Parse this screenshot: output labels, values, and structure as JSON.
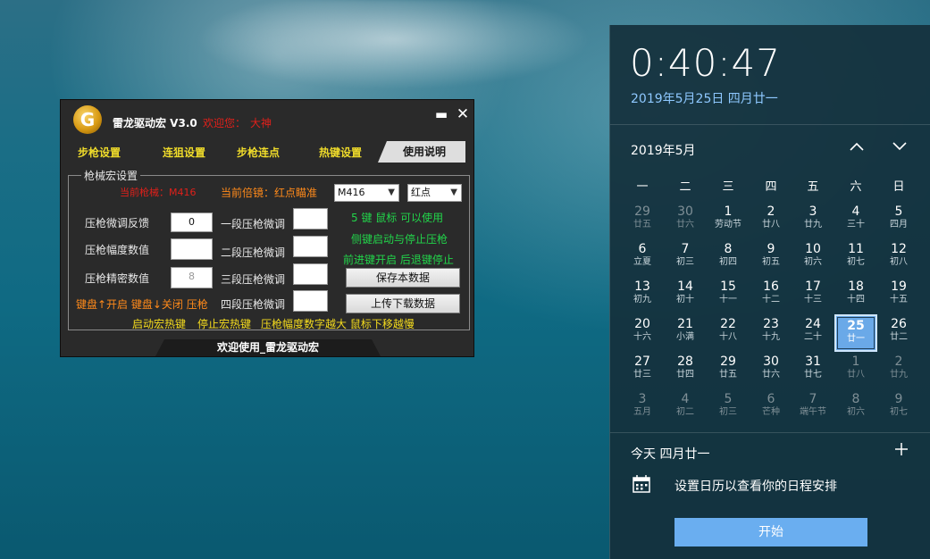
{
  "app": {
    "title": "雷龙驱动宏 V3.0",
    "welcome": "欢迎您：",
    "user": "大神",
    "logo_letter": "G",
    "min_icon": "▬",
    "close_icon": "✕",
    "tabs": [
      "步枪设置",
      "连狙设置",
      "步枪连点",
      "热键设置",
      "使用说明"
    ],
    "group_title": "枪械宏设置",
    "current_gun": "当前枪械：M416",
    "current_scope": "当前倍镜：红点瞄准",
    "gun_select": "M416",
    "scope_select": "红点",
    "fields": {
      "fine_tune_label": "压枪微调反馈",
      "fine_tune_value": "0",
      "amplitude_label": "压枪幅度数值",
      "amplitude_value": "",
      "precision_label": "压枪精密数值",
      "precision_value": "8",
      "stage1_label": "一段压枪微调",
      "stage2_label": "二段压枪微调",
      "stage3_label": "三段压枪微调",
      "stage4_label": "四段压枪微调"
    },
    "hint_mouse5": "5 键 鼠标 可以使用",
    "hint_side": "侧键启动与停止压枪",
    "hint_forward": "前进键开启 后退键停止",
    "save_button": "保存本数据",
    "upload_button": "上传下载数据",
    "keyboard_hint": "键盘↑开启 键盘↓关闭 压枪",
    "bottom_hint1": "启动宏热键",
    "bottom_hint2": "停止宏热键",
    "bottom_hint3": "压枪幅度数字越大 鼠标下移越慢",
    "footer": "欢迎使用_雷龙驱动宏"
  },
  "calendar": {
    "time": "0:40:47",
    "full_date": "2019年5月25日 四月廿一",
    "month": "2019年5月",
    "up_icon": "chevron-up-icon",
    "down_icon": "chevron-down-icon",
    "weekdays": [
      "一",
      "二",
      "三",
      "四",
      "五",
      "六",
      "日"
    ],
    "days": [
      {
        "d": "29",
        "l": "廿五",
        "other": true
      },
      {
        "d": "30",
        "l": "廿六",
        "other": true
      },
      {
        "d": "1",
        "l": "劳动节"
      },
      {
        "d": "2",
        "l": "廿八"
      },
      {
        "d": "3",
        "l": "廿九"
      },
      {
        "d": "4",
        "l": "三十"
      },
      {
        "d": "5",
        "l": "四月"
      },
      {
        "d": "6",
        "l": "立夏"
      },
      {
        "d": "7",
        "l": "初三"
      },
      {
        "d": "8",
        "l": "初四"
      },
      {
        "d": "9",
        "l": "初五"
      },
      {
        "d": "10",
        "l": "初六"
      },
      {
        "d": "11",
        "l": "初七"
      },
      {
        "d": "12",
        "l": "初八"
      },
      {
        "d": "13",
        "l": "初九"
      },
      {
        "d": "14",
        "l": "初十"
      },
      {
        "d": "15",
        "l": "十一"
      },
      {
        "d": "16",
        "l": "十二"
      },
      {
        "d": "17",
        "l": "十三"
      },
      {
        "d": "18",
        "l": "十四"
      },
      {
        "d": "19",
        "l": "十五"
      },
      {
        "d": "20",
        "l": "十六"
      },
      {
        "d": "21",
        "l": "小满"
      },
      {
        "d": "22",
        "l": "十八"
      },
      {
        "d": "23",
        "l": "十九"
      },
      {
        "d": "24",
        "l": "二十"
      },
      {
        "d": "25",
        "l": "廿一",
        "today": true
      },
      {
        "d": "26",
        "l": "廿二"
      },
      {
        "d": "27",
        "l": "廿三"
      },
      {
        "d": "28",
        "l": "廿四"
      },
      {
        "d": "29",
        "l": "廿五"
      },
      {
        "d": "30",
        "l": "廿六"
      },
      {
        "d": "31",
        "l": "廿七"
      },
      {
        "d": "1",
        "l": "廿八",
        "other": true
      },
      {
        "d": "2",
        "l": "廿九",
        "other": true
      },
      {
        "d": "3",
        "l": "五月",
        "other": true
      },
      {
        "d": "4",
        "l": "初二",
        "other": true
      },
      {
        "d": "5",
        "l": "初三",
        "other": true
      },
      {
        "d": "6",
        "l": "芒种",
        "other": true
      },
      {
        "d": "7",
        "l": "端午节",
        "other": true
      },
      {
        "d": "8",
        "l": "初六",
        "other": true
      },
      {
        "d": "9",
        "l": "初七",
        "other": true
      }
    ],
    "agenda_title": "今天 四月廿一",
    "agenda_text": "设置日历以查看你的日程安排",
    "start_button": "开始",
    "accent": "#6aaef0"
  }
}
